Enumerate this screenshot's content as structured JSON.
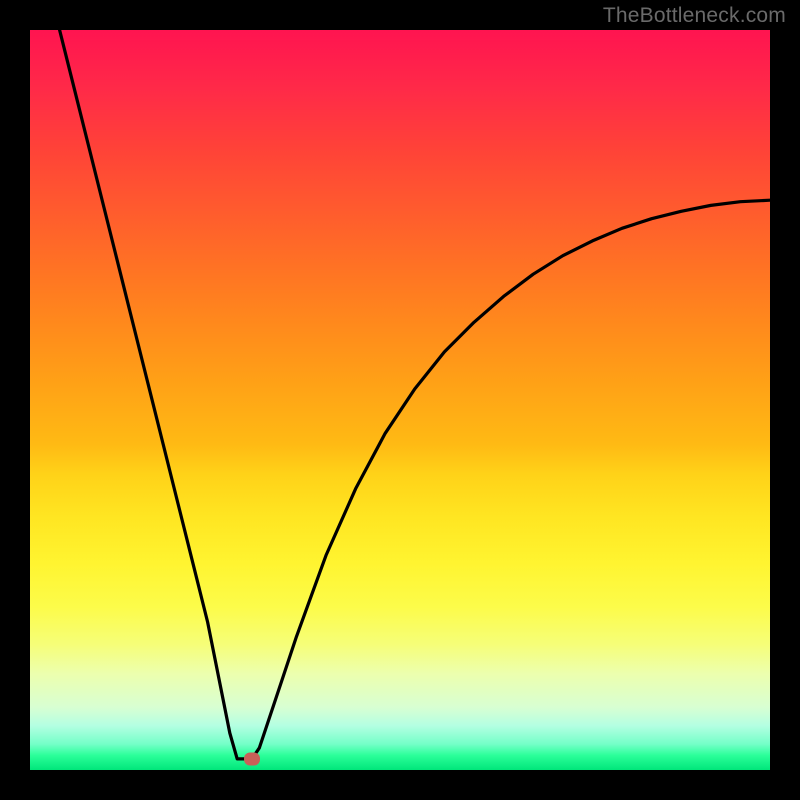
{
  "watermark": "TheBottleneck.com",
  "chart_data": {
    "type": "line",
    "title": "",
    "xlabel": "",
    "ylabel": "",
    "xlim": [
      0,
      100
    ],
    "ylim": [
      0,
      100
    ],
    "series": [
      {
        "name": "bottleneck-curve",
        "x": [
          4,
          6,
          8,
          10,
          12,
          14,
          16,
          18,
          20,
          22,
          24,
          25,
          26,
          27,
          28,
          29,
          30,
          31,
          32,
          34,
          36,
          38,
          40,
          44,
          48,
          52,
          56,
          60,
          64,
          68,
          72,
          76,
          80,
          84,
          88,
          92,
          96,
          100
        ],
        "y": [
          100,
          92,
          84,
          76,
          68,
          60,
          52,
          44,
          36,
          28,
          20,
          15,
          10,
          5,
          1.5,
          1.5,
          1.5,
          3,
          6,
          12,
          18,
          23.5,
          29,
          38,
          45.5,
          51.5,
          56.5,
          60.5,
          64,
          67,
          69.5,
          71.5,
          73.2,
          74.5,
          75.5,
          76.3,
          76.8,
          77
        ]
      }
    ],
    "marker": {
      "x": 30,
      "y": 1.5
    },
    "background_gradient": {
      "top": "#ff1450",
      "mid": "#ffe622",
      "bottom": "#00e67a"
    }
  }
}
